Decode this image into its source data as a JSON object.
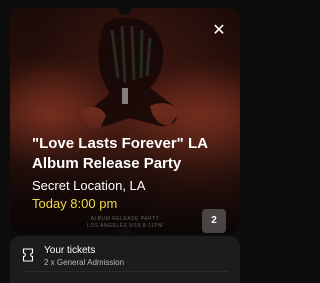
{
  "event": {
    "title": "\"Love Lasts Forever\" LA Album Release Party",
    "venue": "Secret Location, LA",
    "datetime": "Today 8:00 pm",
    "poster_line1": "ALBUM RELEASE PARTY",
    "poster_line2": "LOS ANGELES 8/19 8-11PM",
    "ticket_count": "2",
    "accent_color": "#f2d94a"
  },
  "tickets": {
    "label": "Your tickets",
    "detail": "2 x General Admission",
    "icon": "ticket-icon"
  },
  "close": {
    "icon": "close-icon",
    "glyph": "✕"
  }
}
